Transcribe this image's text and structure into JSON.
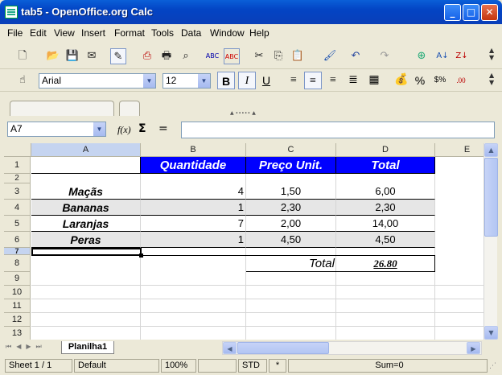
{
  "window": {
    "title": "tab5 - OpenOffice.org Calc"
  },
  "menu": [
    "File",
    "Edit",
    "View",
    "Insert",
    "Format",
    "Tools",
    "Data",
    "Window",
    "Help"
  ],
  "format_toolbar": {
    "font_name": "Arial",
    "font_size": "12"
  },
  "formula_bar": {
    "name_box": "A7",
    "function_label": "f(x)",
    "sum_symbol": "Σ",
    "equals_symbol": "=",
    "input_value": ""
  },
  "columns": [
    "A",
    "B",
    "C",
    "D",
    "E"
  ],
  "rows": [
    "1",
    "2",
    "3",
    "4",
    "5",
    "6",
    "7",
    "8",
    "9",
    "10",
    "11",
    "12",
    "13"
  ],
  "table": {
    "headers": [
      "Quantidade",
      "Preço Unit.",
      "Total"
    ],
    "items": [
      {
        "name": "Maçãs",
        "qty": "4",
        "price": "1,50",
        "total": "6,00"
      },
      {
        "name": "Bananas",
        "qty": "1",
        "price": "2,30",
        "total": "2,30"
      },
      {
        "name": "Laranjas",
        "qty": "7",
        "price": "2,00",
        "total": "14,00"
      },
      {
        "name": "Peras",
        "qty": "1",
        "price": "4,50",
        "total": "4,50"
      }
    ],
    "total_label": "Total",
    "total_value": "26.80"
  },
  "sheet_tab": "Planilha1",
  "status": {
    "sheet": "Sheet 1 / 1",
    "style": "Default",
    "zoom": "100%",
    "mode": "STD",
    "modified": "*",
    "sum": "Sum=0"
  },
  "colors": {
    "header_fill": "#0000ff",
    "header_text": "#ffffff",
    "stripe_fill": "#e6e6e6"
  }
}
